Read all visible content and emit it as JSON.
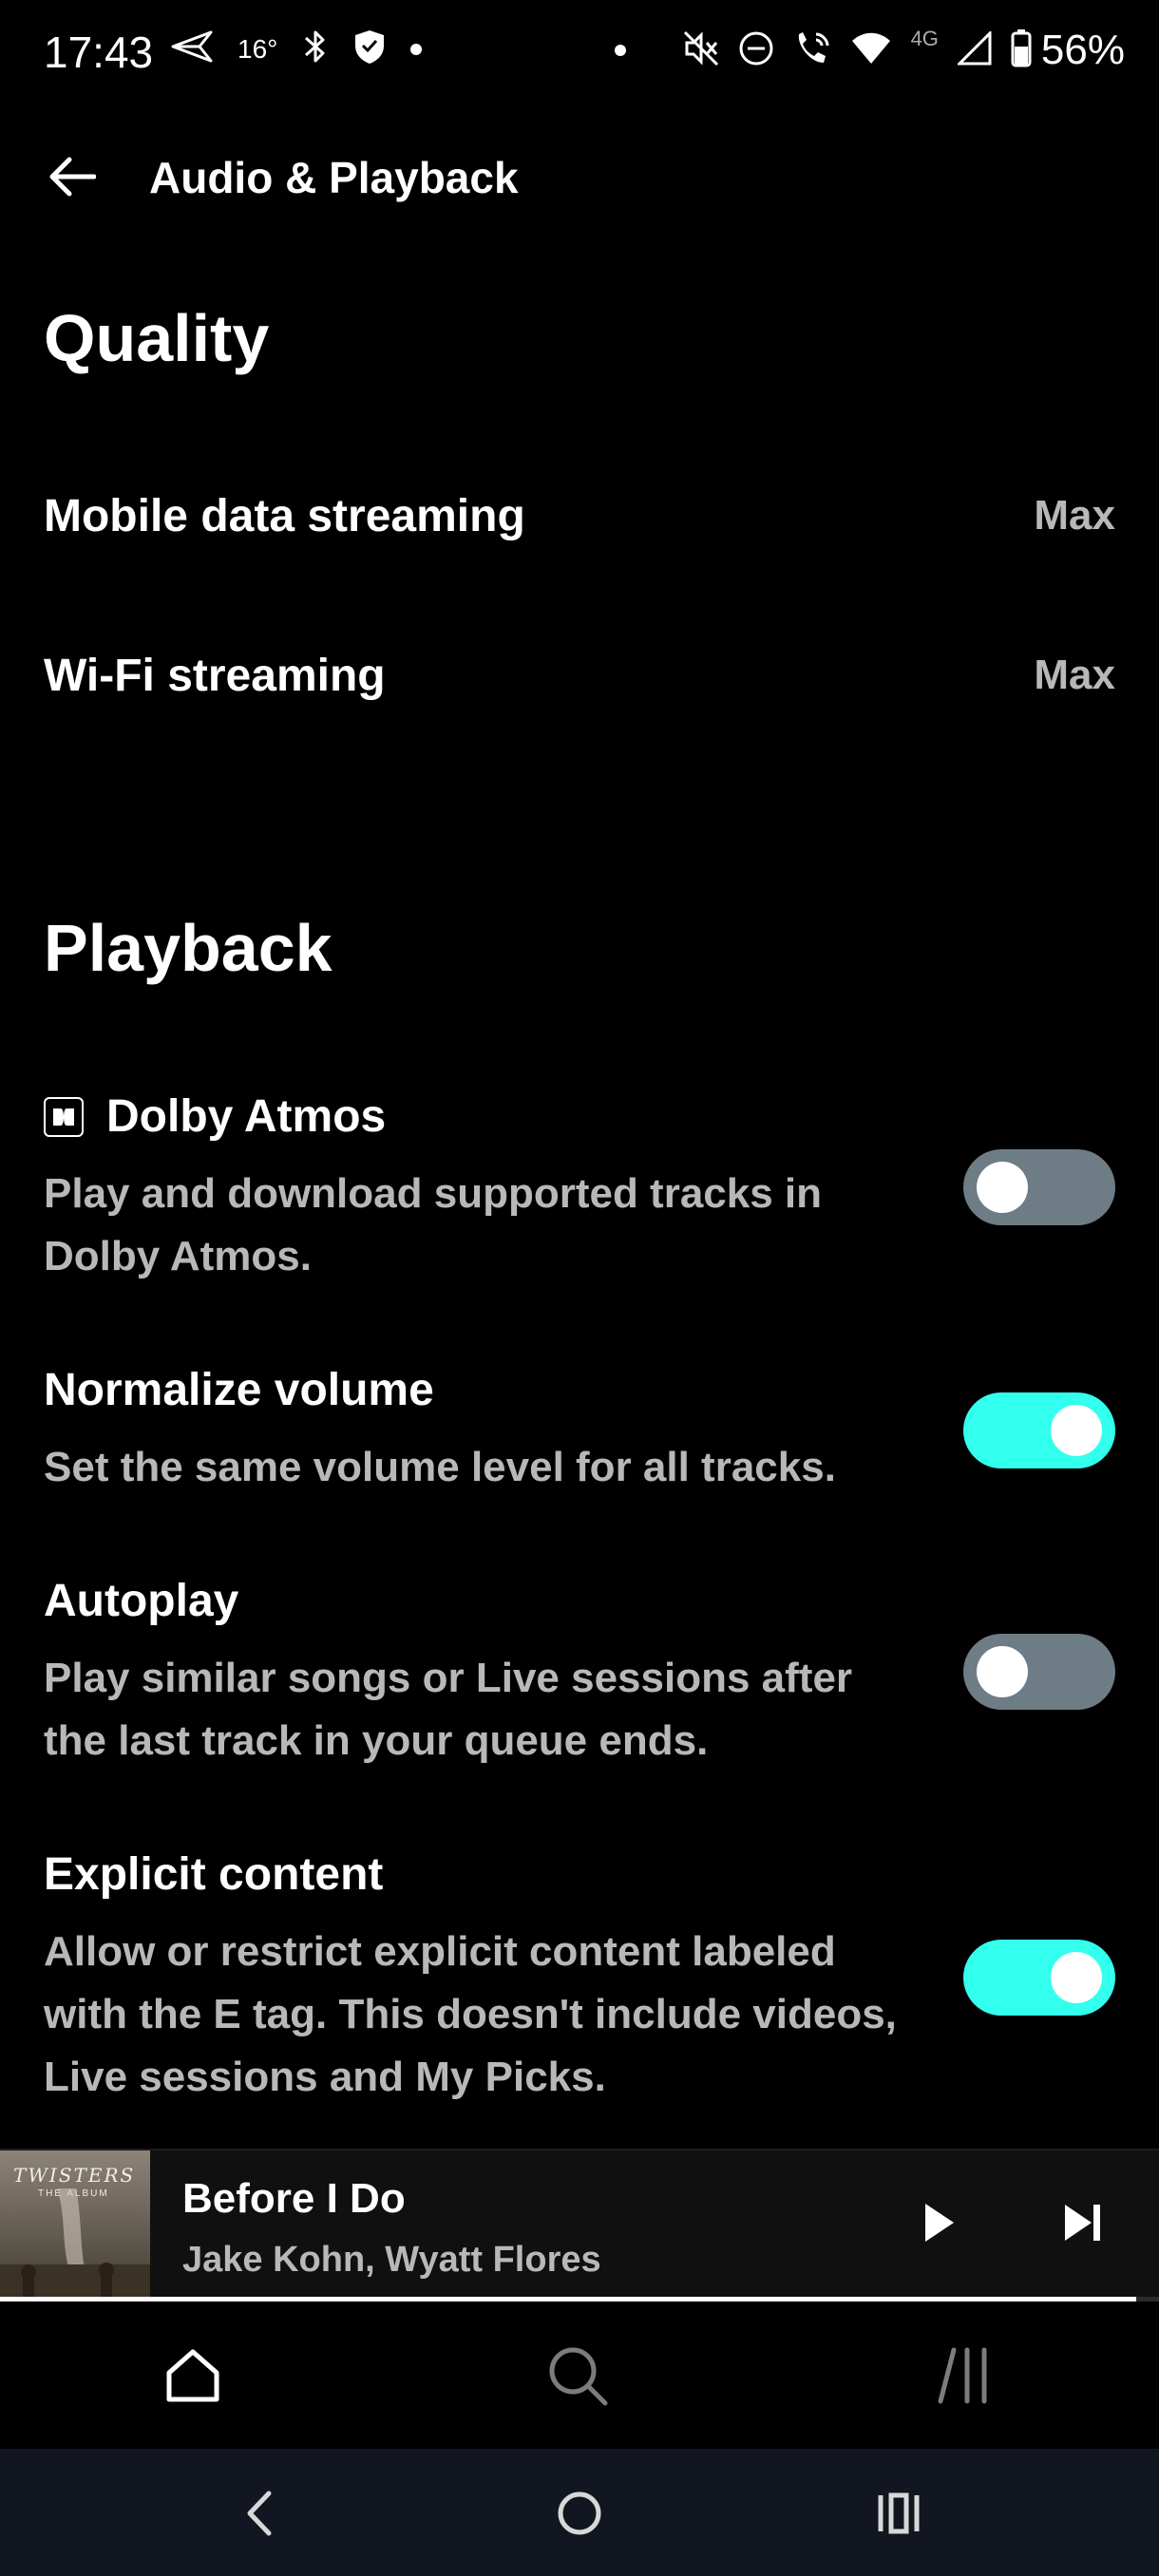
{
  "status_bar": {
    "time": "17:43",
    "temperature": "16°",
    "network_label": "4G",
    "battery": "56%",
    "icons": [
      "send-icon",
      "bluetooth-icon",
      "shield-icon",
      "dot",
      "mute-icon",
      "dnd-icon",
      "wifi-call-icon",
      "wifi-icon",
      "signal-icon",
      "battery-icon"
    ]
  },
  "header": {
    "title": "Audio & Playback",
    "back_icon": "arrow-left-icon"
  },
  "quality": {
    "title": "Quality",
    "rows": [
      {
        "label": "Mobile data streaming",
        "value": "Max"
      },
      {
        "label": "Wi-Fi streaming",
        "value": "Max"
      }
    ]
  },
  "playback": {
    "title": "Playback",
    "items": [
      {
        "title": "Dolby Atmos",
        "description": "Play and download supported tracks in Dolby Atmos.",
        "enabled": false,
        "icon": "dolby-icon"
      },
      {
        "title": "Normalize volume",
        "description": "Set the same volume level for all tracks.",
        "enabled": true
      },
      {
        "title": "Autoplay",
        "description": "Play similar songs or Live sessions after the last track in your queue ends.",
        "enabled": false
      },
      {
        "title": "Explicit content",
        "description": "Allow or restrict explicit content labeled with the E tag. This doesn't include videos, Live sessions and My Picks.",
        "enabled": true
      }
    ]
  },
  "now_playing": {
    "title": "Before I Do",
    "artist": "Jake Kohn, Wyatt Flores",
    "album_art_text": "TWISTERS",
    "album_art_subtext": "THE ALBUM",
    "progress": 0.98
  },
  "bottom_nav": {
    "items": [
      "home-icon",
      "search-icon",
      "library-icon"
    ]
  },
  "colors": {
    "accent": "#33ffee",
    "toggle_off": "#6e7c86",
    "secondary_text": "#b8b8b8"
  }
}
